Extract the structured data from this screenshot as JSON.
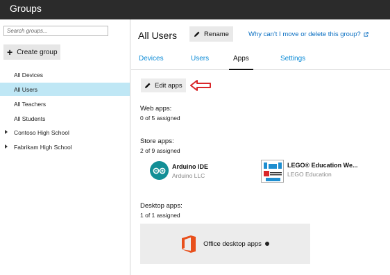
{
  "topbar": {
    "title": "Groups"
  },
  "sidebar": {
    "search_placeholder": "Search groups...",
    "create_label": "Create group",
    "items": [
      {
        "label": "All Devices",
        "selected": false,
        "expandable": false
      },
      {
        "label": "All Users",
        "selected": true,
        "expandable": false
      },
      {
        "label": "All Teachers",
        "selected": false,
        "expandable": false
      },
      {
        "label": "All Students",
        "selected": false,
        "expandable": false
      },
      {
        "label": "Contoso High School",
        "selected": false,
        "expandable": true
      },
      {
        "label": "Fabrikam High School",
        "selected": false,
        "expandable": true
      }
    ]
  },
  "main": {
    "title": "All Users",
    "rename_label": "Rename",
    "help_link": "Why can't I move or delete this group?",
    "tabs": [
      {
        "label": "Devices",
        "active": false
      },
      {
        "label": "Users",
        "active": false
      },
      {
        "label": "Apps",
        "active": true
      },
      {
        "label": "Settings",
        "active": false
      }
    ],
    "edit_apps_label": "Edit apps",
    "web_apps": {
      "title": "Web apps:",
      "assigned": "0 of 5 assigned"
    },
    "store_apps": {
      "title": "Store apps:",
      "assigned": "2 of 9 assigned",
      "apps": [
        {
          "name": "Arduino IDE",
          "publisher": "Arduino LLC",
          "icon": "arduino-logo"
        },
        {
          "name": "LEGO® Education We...",
          "publisher": "LEGO Education",
          "icon": "lego-education-logo"
        }
      ]
    },
    "desktop_apps": {
      "title": "Desktop apps:",
      "assigned": "1 of 1 assigned",
      "office_label": "Office desktop apps"
    }
  },
  "colors": {
    "topbar": "#2b2b2b",
    "accent": "#0a8ad6",
    "selected": "#bfe7f5",
    "arrow": "#d9262a",
    "office": "#e8501c",
    "arduino": "#138f96"
  }
}
